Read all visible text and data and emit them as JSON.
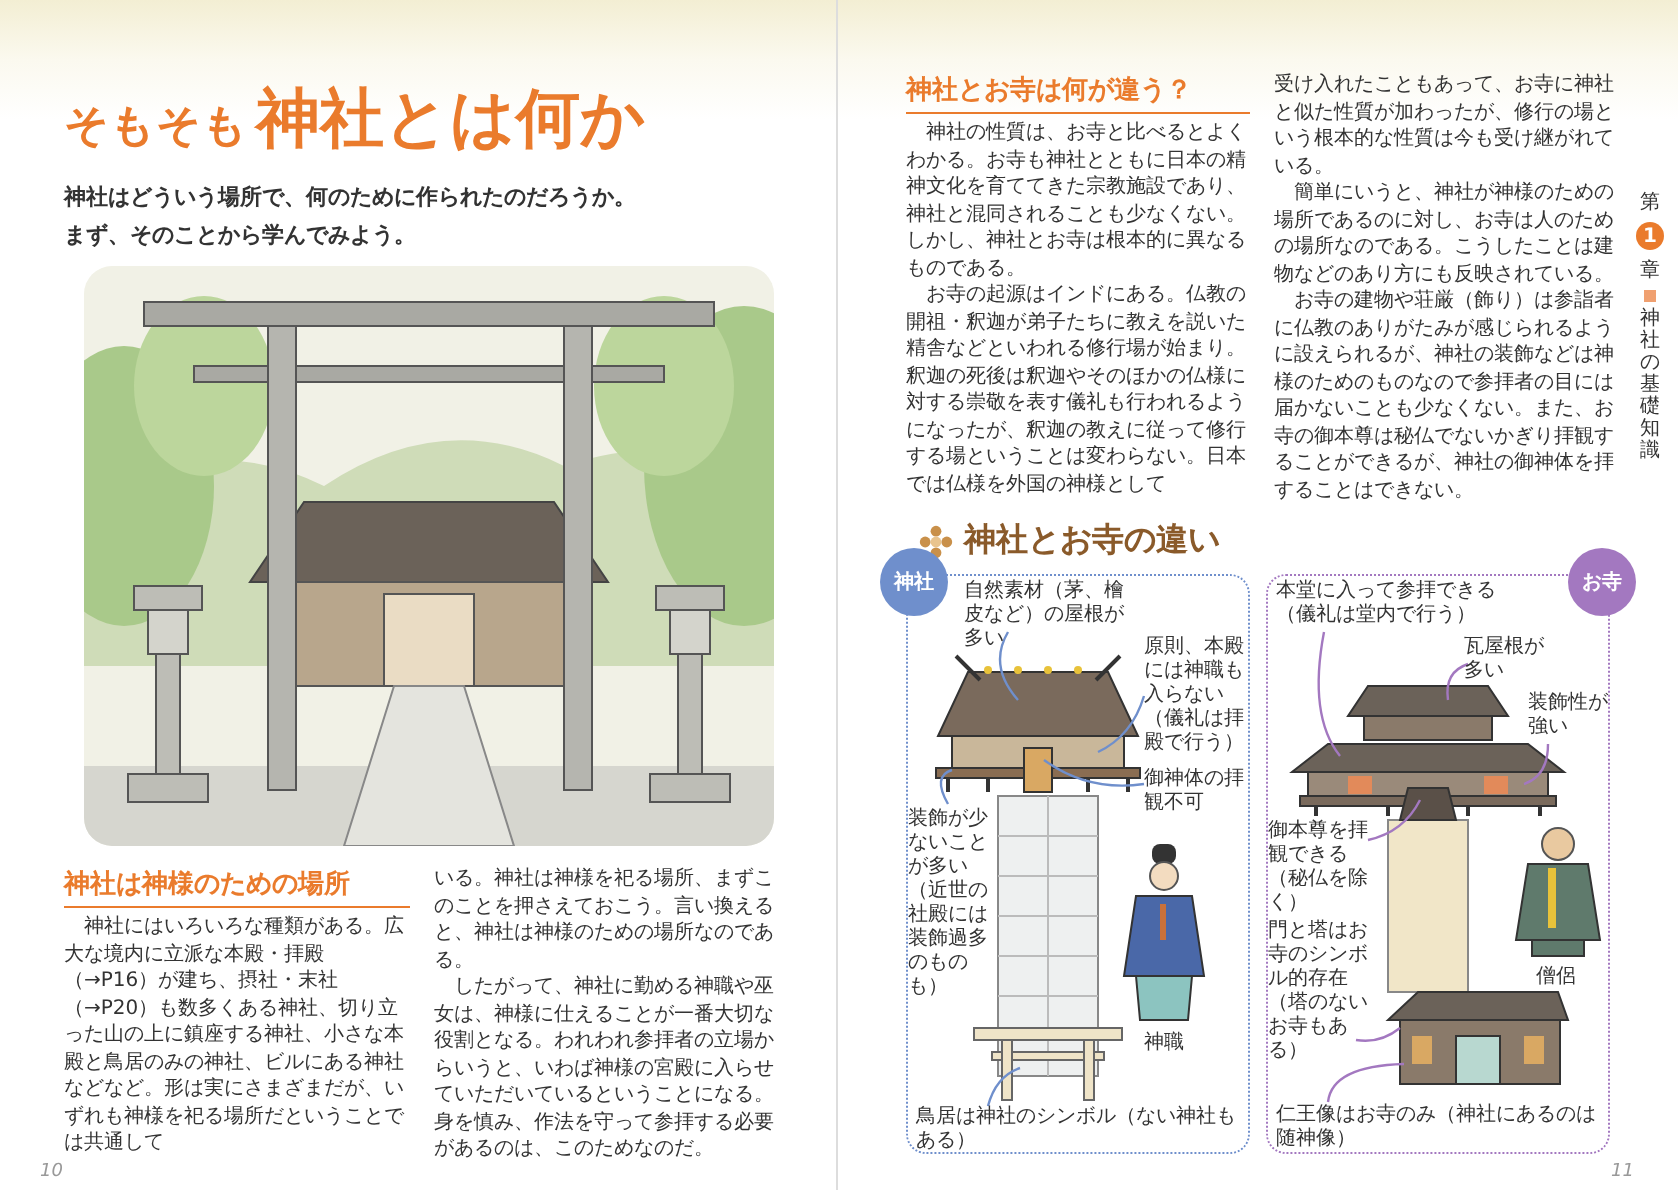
{
  "left_page": {
    "title_prefix": "そもそも",
    "title_main": "神社とは何か",
    "intro": [
      "神社はどういう場所で、何のために作られたのだろうか。",
      "まず、そのことから学んでみよう。"
    ],
    "section": {
      "heading": "神社は神様のための場所",
      "column_1": [
        {
          "text": "神社にはいろいろな種類がある。広大な境内に立派な本殿・拝殿（→P16）が建ち、摂社・末社（→P20）も数多くある神社、切り立った山の上に鎮座する神社、小さな本殿と鳥居のみの神社、ビルにある神社などなど。形は実にさまざまだが、いずれも神様を祀る場所だということでは共通して",
          "indent": true
        }
      ],
      "column_2": [
        {
          "text": "いる。神社は神様を祀る場所、まずこのことを押さえておこう。言い換えると、神社は神様のための場所なのである。",
          "indent": false
        },
        {
          "text": "したがって、神社に勤める神職や巫女は、神様に仕えることが一番大切な役割となる。われわれ参拝者の立場からいうと、いわば神様の宮殿に入らせていただいているということになる。身を慎み、作法を守って参拝する必要があるのは、このためなのだ。",
          "indent": true
        }
      ]
    },
    "page_number": "10"
  },
  "right_page": {
    "section": {
      "heading": "神社とお寺は何が違う？",
      "column_1": [
        {
          "text": "神社の性質は、お寺と比べるとよくわかる。お寺も神社とともに日本の精神文化を育ててきた宗教施設であり、神社と混同されることも少なくない。しかし、神社とお寺は根本的に異なるものである。",
          "indent": true
        },
        {
          "text": "お寺の起源はインドにある。仏教の開祖・釈迦が弟子たちに教えを説いた精舎などといわれる修行場が始まり。釈迦の死後は釈迦やそのほかの仏様に対する崇敬を表す儀礼も行われるようになったが、釈迦の教えに従って修行する場ということは変わらない。日本では仏様を外国の神様として",
          "indent": true
        }
      ],
      "column_2": [
        {
          "text": "受け入れたこともあって、お寺に神社と似た性質が加わったが、修行の場という根本的な性質は今も受け継がれている。",
          "indent": false
        },
        {
          "text": "簡単にいうと、神社が神様のための場所であるのに対し、お寺は人のための場所なのである。こうしたことは建物などのあり方にも反映されている。",
          "indent": true
        },
        {
          "text": "お寺の建物や荘厳（飾り）は参詣者に仏教のありがたみが感じられるように設えられるが、神社の装飾などは神様のためのものなので参拝者の目には届かないことも少なくない。また、お寺の御本尊は秘仏でないかぎり拝観することができるが、神社の御神体を拝することはできない。",
          "indent": true
        }
      ]
    },
    "comparison": {
      "heading": "神社とお寺の違い",
      "panels": [
        {
          "kind": "shrine",
          "tag": "神社",
          "labels": [
            "自然素材（茅、檜皮など）の屋根が多い",
            "原則、本殿には神職も入らない（儀礼は拝殿で行う）",
            "御神体の拝観不可",
            "装飾が少ないことが多い（近世の社殿には装飾過多のものも）",
            "鳥居は神社のシンボル（ない神社もある）"
          ],
          "figure_caption": "神職"
        },
        {
          "kind": "temple",
          "tag": "お寺",
          "labels": [
            "本堂に入って参拝できる（儀礼は堂内で行う）",
            "瓦屋根が多い",
            "装飾性が強い",
            "御本尊を拝観できる（秘仏を除く）",
            "門と塔はお寺のシンボル的存在（塔のないお寺もある）",
            "仁王像はお寺のみ（神社にあるのは随神像）"
          ],
          "figure_caption": "僧侶"
        }
      ]
    },
    "chapter_tab": {
      "label_top": "第",
      "number": "1",
      "label_bottom": "章",
      "title": "神社の基礎知識"
    },
    "page_number": "11"
  }
}
